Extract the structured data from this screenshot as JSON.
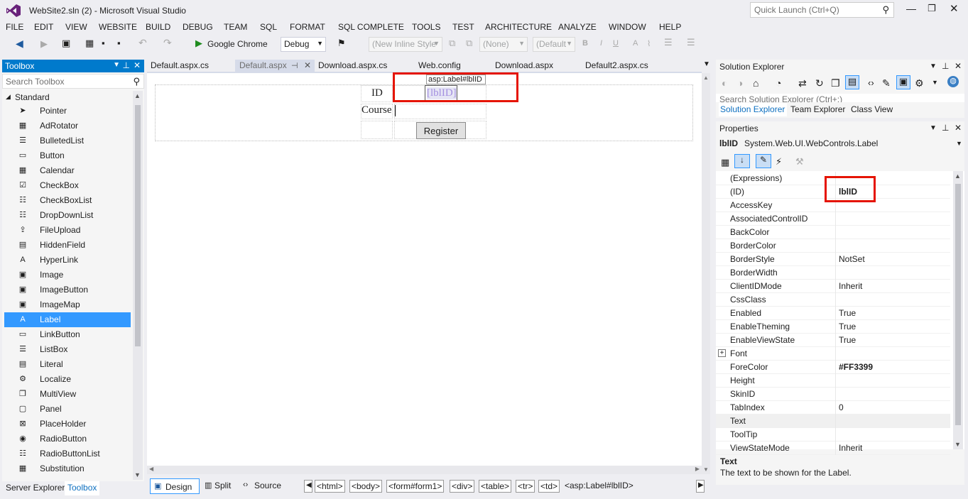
{
  "window": {
    "title": "WebSite2.sln (2) - Microsoft Visual Studio",
    "quick_launch": "Quick Launch (Ctrl+Q)"
  },
  "menu": [
    "FILE",
    "EDIT",
    "VIEW",
    "WEBSITE",
    "BUILD",
    "DEBUG",
    "TEAM",
    "SQL",
    "FORMAT",
    "SQL COMPLETE",
    "TOOLS",
    "TEST",
    "ARCHITECTURE",
    "ANALYZE",
    "WINDOW",
    "HELP"
  ],
  "toolbar": {
    "browser": "Google Chrome",
    "config": "Debug",
    "style": "(New Inline Style",
    "target": "(None)",
    "font": "(Default"
  },
  "toolbox": {
    "title": "Toolbox",
    "search_placeholder": "Search Toolbox",
    "group": "Standard",
    "items": [
      {
        "label": "Pointer",
        "icon": "pointer-icon",
        "glyph": "➤"
      },
      {
        "label": "AdRotator",
        "icon": "adrotator-icon",
        "glyph": "▦"
      },
      {
        "label": "BulletedList",
        "icon": "bulletedlist-icon",
        "glyph": "☰"
      },
      {
        "label": "Button",
        "icon": "button-icon",
        "glyph": "▭"
      },
      {
        "label": "Calendar",
        "icon": "calendar-icon",
        "glyph": "▦"
      },
      {
        "label": "CheckBox",
        "icon": "checkbox-icon",
        "glyph": "☑"
      },
      {
        "label": "CheckBoxList",
        "icon": "checkboxlist-icon",
        "glyph": "☷"
      },
      {
        "label": "DropDownList",
        "icon": "dropdownlist-icon",
        "glyph": "☷"
      },
      {
        "label": "FileUpload",
        "icon": "fileupload-icon",
        "glyph": "⇪"
      },
      {
        "label": "HiddenField",
        "icon": "hiddenfield-icon",
        "glyph": "▤"
      },
      {
        "label": "HyperLink",
        "icon": "hyperlink-icon",
        "glyph": "A"
      },
      {
        "label": "Image",
        "icon": "image-icon",
        "glyph": "▣"
      },
      {
        "label": "ImageButton",
        "icon": "imagebutton-icon",
        "glyph": "▣"
      },
      {
        "label": "ImageMap",
        "icon": "imagemap-icon",
        "glyph": "▣"
      },
      {
        "label": "Label",
        "icon": "label-icon",
        "glyph": "A"
      },
      {
        "label": "LinkButton",
        "icon": "linkbutton-icon",
        "glyph": "▭"
      },
      {
        "label": "ListBox",
        "icon": "listbox-icon",
        "glyph": "☰"
      },
      {
        "label": "Literal",
        "icon": "literal-icon",
        "glyph": "▤"
      },
      {
        "label": "Localize",
        "icon": "localize-icon",
        "glyph": "⚙"
      },
      {
        "label": "MultiView",
        "icon": "multiview-icon",
        "glyph": "❐"
      },
      {
        "label": "Panel",
        "icon": "panel-icon",
        "glyph": "▢"
      },
      {
        "label": "PlaceHolder",
        "icon": "placeholder-icon",
        "glyph": "⊠"
      },
      {
        "label": "RadioButton",
        "icon": "radiobutton-icon",
        "glyph": "◉"
      },
      {
        "label": "RadioButtonList",
        "icon": "radiobuttonlist-icon",
        "glyph": "☷"
      },
      {
        "label": "Substitution",
        "icon": "substitution-icon",
        "glyph": "▦"
      }
    ],
    "bottom_tabs": [
      "Server Explorer",
      "Toolbox"
    ]
  },
  "doc_tabs": [
    "Default.aspx.cs",
    "Default.aspx",
    "Download.aspx.cs",
    "Web.config",
    "Download.aspx",
    "Default2.aspx.cs"
  ],
  "designer": {
    "tag_tooltip": "asp:Label#lblID",
    "id_label": "ID",
    "course_label": "Course",
    "label_control": "[lblID]",
    "register_button": "Register"
  },
  "view_tabs": [
    "Design",
    "Split",
    "Source"
  ],
  "breadcrumbs": [
    "<html>",
    "<body>",
    "<form#form1>",
    "<div>",
    "<table>",
    "<tr>",
    "<td>",
    "<asp:Label#lblID>"
  ],
  "solution_explorer": {
    "title": "Solution Explorer",
    "search_placeholder": "Search Solution Explorer (Ctrl+;)",
    "tabs": [
      "Solution Explorer",
      "Team Explorer",
      "Class View"
    ]
  },
  "properties": {
    "title": "Properties",
    "object": "lblID",
    "object_type": "System.Web.UI.WebControls.Label",
    "rows": [
      {
        "name": "(Expressions)",
        "value": ""
      },
      {
        "name": "(ID)",
        "value": "lblID"
      },
      {
        "name": "AccessKey",
        "value": ""
      },
      {
        "name": "AssociatedControlID",
        "value": ""
      },
      {
        "name": "BackColor",
        "value": ""
      },
      {
        "name": "BorderColor",
        "value": ""
      },
      {
        "name": "BorderStyle",
        "value": "NotSet"
      },
      {
        "name": "BorderWidth",
        "value": ""
      },
      {
        "name": "ClientIDMode",
        "value": "Inherit"
      },
      {
        "name": "CssClass",
        "value": ""
      },
      {
        "name": "Enabled",
        "value": "True"
      },
      {
        "name": "EnableTheming",
        "value": "True"
      },
      {
        "name": "EnableViewState",
        "value": "True"
      },
      {
        "name": "Font",
        "value": ""
      },
      {
        "name": "ForeColor",
        "value": "#FF3399"
      },
      {
        "name": "Height",
        "value": ""
      },
      {
        "name": "SkinID",
        "value": ""
      },
      {
        "name": "TabIndex",
        "value": "0"
      },
      {
        "name": "Text",
        "value": ""
      },
      {
        "name": "ToolTip",
        "value": ""
      },
      {
        "name": "ViewStateMode",
        "value": "Inherit"
      }
    ],
    "desc_title": "Text",
    "desc_text": "The text to be shown for the Label."
  },
  "colors": {
    "accent": "#007acc",
    "selection": "#3399ff",
    "highlight": "#e51400",
    "label_text": "#a38fe0"
  }
}
